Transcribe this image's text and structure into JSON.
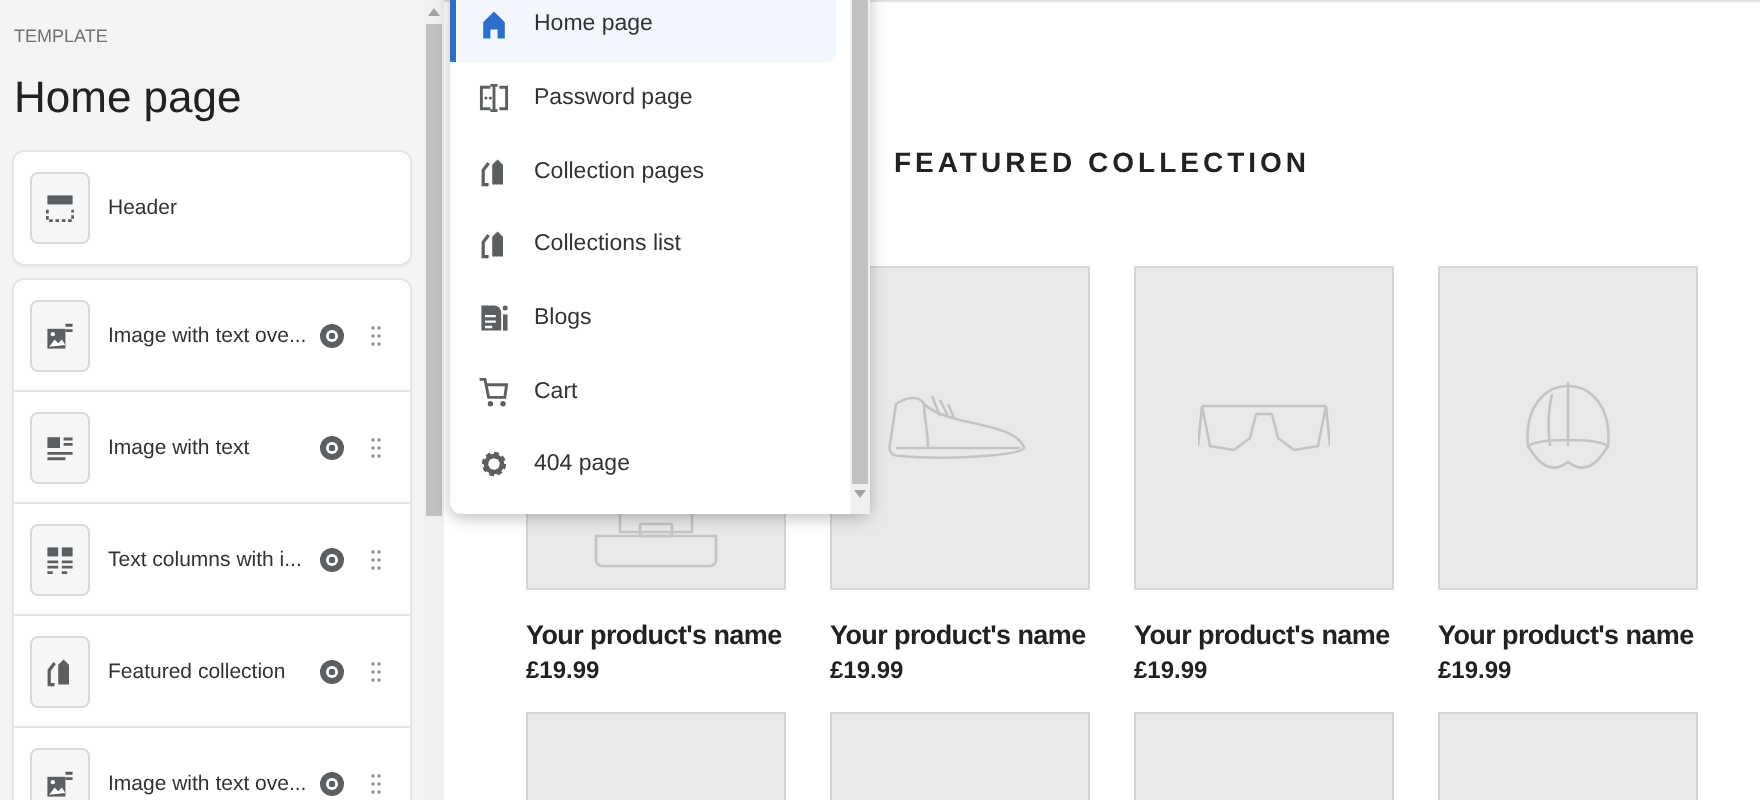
{
  "sidebar": {
    "eyebrow": "TEMPLATE",
    "title": "Home page",
    "header_section": {
      "label": "Header",
      "kind": "header"
    },
    "sections": [
      {
        "label": "Image with text ove...",
        "kind": "image-overlay"
      },
      {
        "label": "Image with text",
        "kind": "image-text"
      },
      {
        "label": "Text columns with i...",
        "kind": "columns"
      },
      {
        "label": "Featured collection",
        "kind": "tag"
      },
      {
        "label": "Image with text ove...",
        "kind": "image-overlay"
      }
    ]
  },
  "template_menu": {
    "items": [
      {
        "label": "Home page",
        "kind": "home",
        "selected": true
      },
      {
        "label": "Password page",
        "kind": "password",
        "selected": false
      },
      {
        "label": "Collection pages",
        "kind": "tag",
        "selected": false
      },
      {
        "label": "Collections list",
        "kind": "tag",
        "selected": false
      },
      {
        "label": "Blogs",
        "kind": "blog",
        "selected": false
      },
      {
        "label": "Cart",
        "kind": "cart",
        "selected": false
      },
      {
        "label": "404 page",
        "kind": "gear",
        "selected": false
      }
    ]
  },
  "preview": {
    "heading": "FEATURED COLLECTION",
    "products": [
      {
        "kind": "stand",
        "name": "Your product's name",
        "price": "£19.99"
      },
      {
        "kind": "shoe",
        "name": "Your product's name",
        "price": "£19.99"
      },
      {
        "kind": "glasses",
        "name": "Your product's name",
        "price": "£19.99"
      },
      {
        "kind": "cap",
        "name": "Your product's name",
        "price": "£19.99"
      },
      {
        "kind": "cut-off"
      },
      {
        "kind": "cut-off"
      },
      {
        "kind": "cut-off"
      },
      {
        "kind": "cut-off"
      }
    ]
  }
}
